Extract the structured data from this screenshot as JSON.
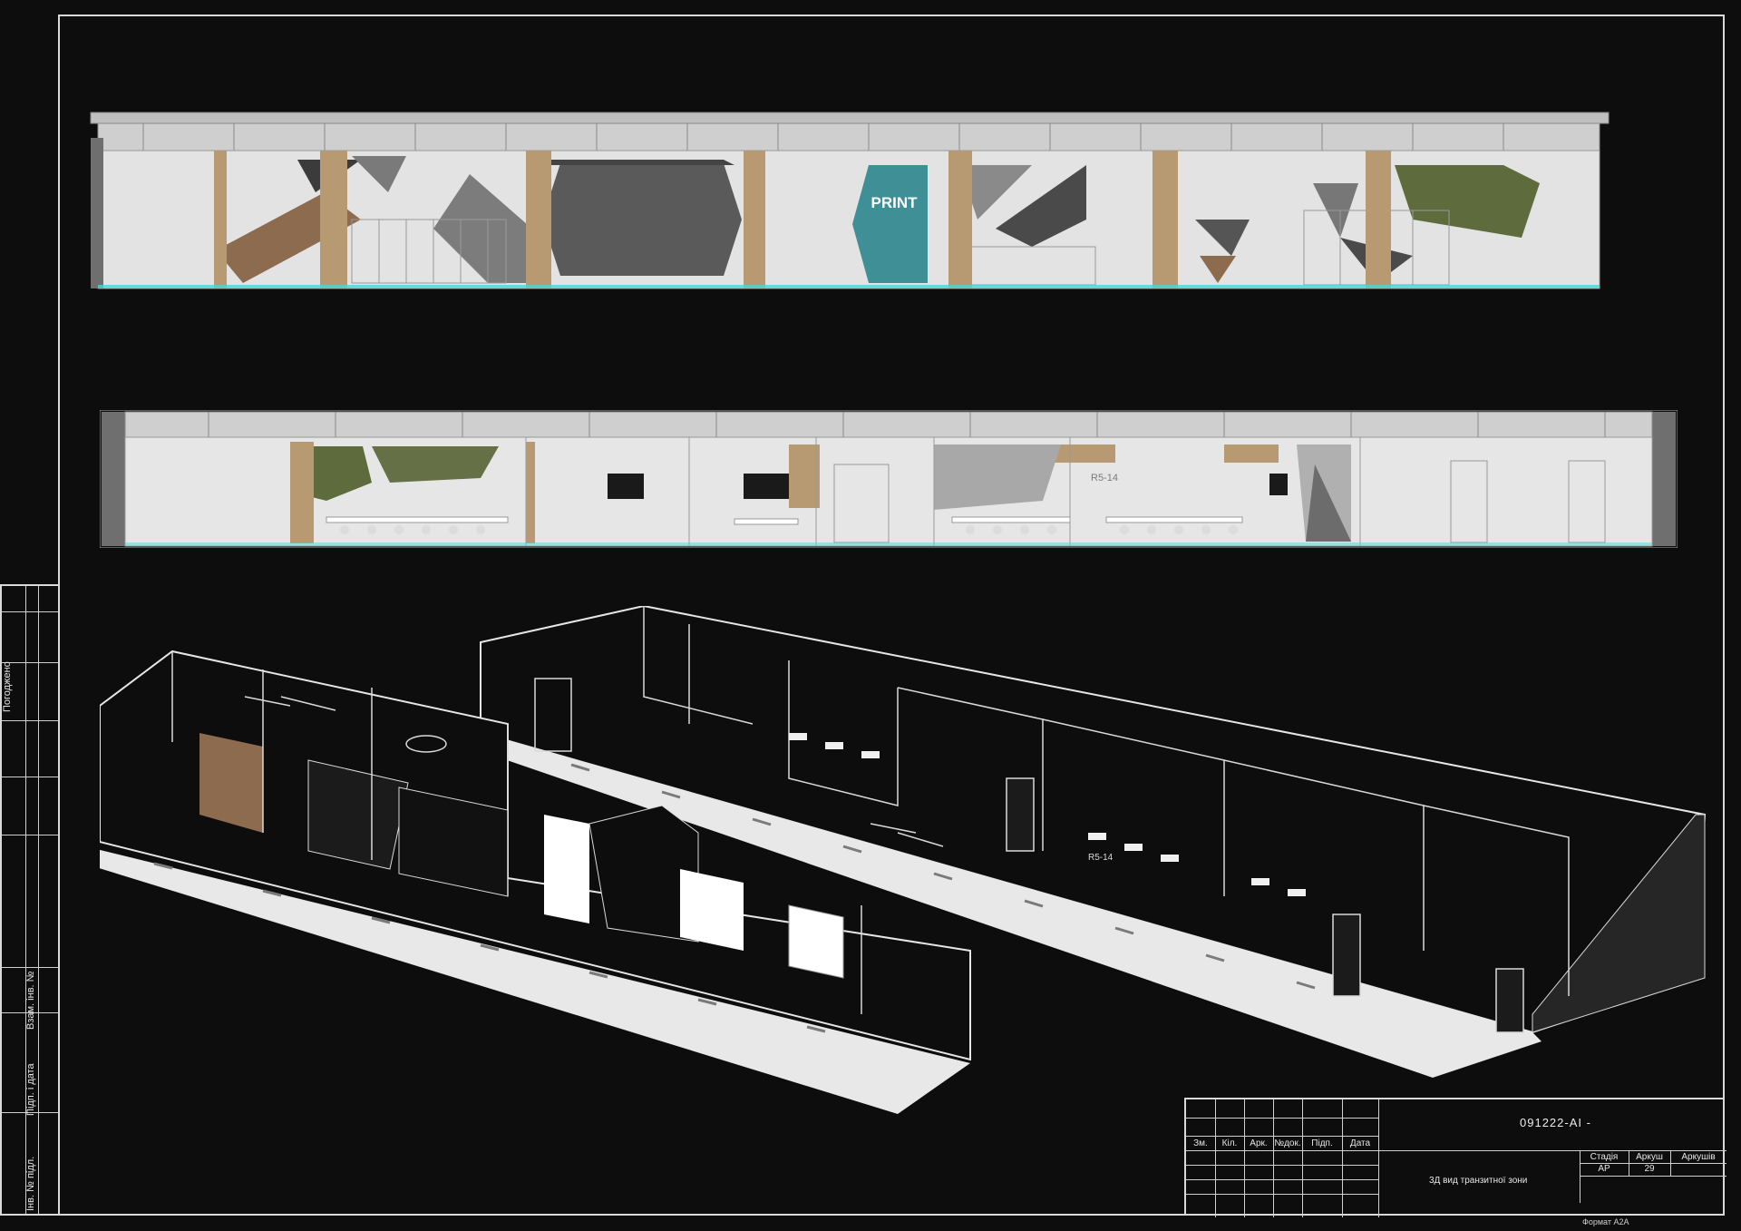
{
  "drawing": {
    "code": "091222-АІ -",
    "title": "3Д вид транзитної зони",
    "format_label": "Формат А2А",
    "sign_text": "PRINT",
    "room_tag": "R5-14"
  },
  "side_stamp": {
    "labels": [
      "Погоджено",
      "Взам. інв. №",
      "Підп. і дата",
      "Інв. № підл."
    ]
  },
  "title_block": {
    "headers": [
      "Зм.",
      "Кіл.",
      "Арк.",
      "№док.",
      "Підп.",
      "Дата"
    ],
    "stage_header": "Стадія",
    "sheet_header": "Аркуш",
    "sheets_header": "Аркушів",
    "stage_value": "АР",
    "sheet_value": "29"
  },
  "colors": {
    "background": "#0d0d0d",
    "line": "#d9d9d9",
    "wall": "#d8d8d8",
    "wood": "#b79a72",
    "teal": "#3f8f96",
    "green": "#5e6b3d",
    "floor_accent": "#47d6d6"
  }
}
